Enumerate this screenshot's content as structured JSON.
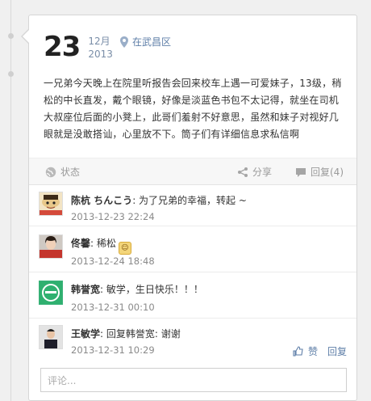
{
  "post": {
    "day": "23",
    "month": "12月",
    "year": "2013",
    "location": "在武昌区",
    "text": "一兄弟今天晚上在院里听报告会回来校车上遇一可爱妹子，13级，稍松的中长直发，戴个眼镜，好像是淡蓝色书包不太记得，就坐在司机大叔座位后面的小凳上，此哥们羞射不好意思，虽然和妹子对视好几眼就是没敢搭讪，心里放不下。筒子们有详细信息求私信啊"
  },
  "actions": {
    "status_label": "状态",
    "share_label": "分享",
    "reply_label": "回复(4)"
  },
  "comments": [
    {
      "author": "陈杭 ちんこう",
      "text": ": 为了兄弟的幸福，转起 ~",
      "time": "2013-12-23 22:24",
      "emoji": ""
    },
    {
      "author": "佟馨",
      "text": ": 稀松",
      "time": "2013-12-24 18:48",
      "emoji": "emoji-face"
    },
    {
      "author": "韩誉宽",
      "text": ": 敏学，生日快乐！！！",
      "time": "2013-12-31 00:10",
      "emoji": ""
    },
    {
      "author": "王敏学",
      "text": ": 回复韩誉宽: 谢谢",
      "time": "2013-12-31 10:29",
      "emoji": ""
    }
  ],
  "comment_actions": {
    "like_label": "赞",
    "reply_label": "回复"
  },
  "comment_input": {
    "placeholder": "评论..."
  },
  "colors": {
    "accent": "#5f7fa8",
    "muted": "#9a9a9a"
  }
}
